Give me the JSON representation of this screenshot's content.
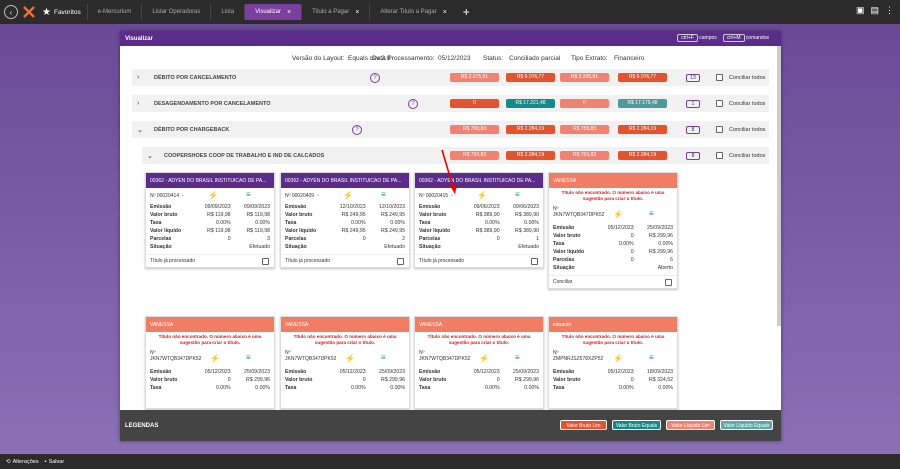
{
  "favorites_label": "Favoritos",
  "tabs": [
    {
      "label": "e-Mercurium"
    },
    {
      "label": "Listar Operadoras"
    },
    {
      "label": "Lista"
    },
    {
      "label": "Visualizar",
      "active": true
    },
    {
      "label": "Titulo a Pagar"
    },
    {
      "label": "Alterar Titulo a Pagar"
    }
  ],
  "window": {
    "title": "Visualizar",
    "kb1": "ctrl+F",
    "kb1_label": "campos",
    "kb2": "ctrl+M",
    "kb2_label": "comandos"
  },
  "info": {
    "layout_label": "Versão do Layout:",
    "layout_value": "Equals csv 2.0",
    "proc_label": "Data Processamento:",
    "proc_value": "05/12/2023",
    "status_label": "Status:",
    "status_value": "Conciliado parcial",
    "tipo_label": "Tipo Extrato:",
    "tipo_value": "Financeiro"
  },
  "rows": [
    {
      "label": "DÉBITO POR CANCELAMENTO",
      "pills": [
        "R$ 2.275,91",
        "R$ 6.076,77",
        "R$ 2.200,91",
        "R$ 6.076,77"
      ],
      "count": "13",
      "conciliar": "Conciliar todos",
      "chev": "›"
    },
    {
      "label": "DESAGENDAMENTO POR CANCELAMENTO",
      "pills": [
        "0",
        "R$ 17.221,48",
        "0",
        "R$ 17.179,48"
      ],
      "count": "1",
      "conciliar": "Conciliar todos",
      "chev": "›"
    },
    {
      "label": "DÉBITO POR CHARGEBACK",
      "pills": [
        "R$ 759,83",
        "R$ 2.284,19",
        "R$ 759,83",
        "R$ 2.284,19"
      ],
      "count": "8",
      "conciliar": "Conciliar todos",
      "chev": "⌄"
    },
    {
      "label": "COOPERSHOES COOP DE TRABALHO E IND DE CALCADOS",
      "pills": [
        "R$ 759,83",
        "R$ 2.284,19",
        "R$ 759,83",
        "R$ 2.284,19"
      ],
      "count": "8",
      "conciliar": "Conciliar todos",
      "chev": "⌄"
    }
  ],
  "cards_row1": [
    {
      "title": "00362 - ADYEN DO BRASIL INSTITUICAO DE PA...",
      "nr": "Nº 00020414",
      "emissao": [
        "09/09/2023",
        "09/09/2023"
      ],
      "bruto": [
        "R$ 119,98",
        "R$ 119,98"
      ],
      "taxa": [
        "0.00%",
        "0.00%"
      ],
      "liquido": [
        "R$ 119,98",
        "R$ 119,98"
      ],
      "parcelas": [
        "0",
        "3"
      ],
      "situacao": "Efetuado",
      "footer": "Título já processado"
    },
    {
      "title": "00362 - ADYEN DO BRASIL INSTITUICAO DE PA...",
      "nr": "Nº 00020409",
      "emissao": [
        "12/10/2023",
        "12/10/2023"
      ],
      "bruto": [
        "R$ 249,95",
        "R$ 249,95"
      ],
      "taxa": [
        "0.00%",
        "0.00%"
      ],
      "liquido": [
        "R$ 249,95",
        "R$ 249,95"
      ],
      "parcelas": [
        "0",
        "2"
      ],
      "situacao": "Efetuado",
      "footer": "Título já processado"
    },
    {
      "title": "00362 - ADYEN DO BRASIL INSTITUICAO DE PA...",
      "nr": "Nº 00020415",
      "emissao": [
        "09/06/2023",
        "09/06/2023"
      ],
      "bruto": [
        "R$ 389,90",
        "R$ 389,90"
      ],
      "taxa": [
        "0.00%",
        "0.00%"
      ],
      "liquido": [
        "R$ 389,90",
        "R$ 389,90"
      ],
      "parcelas": [
        "0",
        "1"
      ],
      "situacao": "Efetuado",
      "footer": "Título já processado"
    },
    {
      "title": "VANESSA",
      "err": "Título não encontrado. O número abaixo é uma sugestão para criar o título.",
      "nr_label": "Nº",
      "nr": "JKN7WTQB347DPK52",
      "emissao": [
        "05/12/2023",
        "25/09/2023"
      ],
      "bruto": [
        "0",
        "R$ 299,96"
      ],
      "taxa": [
        "0.00%",
        "0.00%"
      ],
      "liquido": [
        "0",
        "R$ 299,96"
      ],
      "parcelas": [
        "0",
        "6"
      ],
      "situacao": "Aberto",
      "footer": "Conciliar"
    }
  ],
  "cards_row2": [
    {
      "title": "VANESSA",
      "err": "Título não encontrado. O número abaixo é uma sugestão para criar o título.",
      "nr_label": "Nº",
      "nr": "JKN7WTQB347DPK52",
      "emissao": [
        "05/12/2023",
        "25/09/2023"
      ],
      "bruto": [
        "0",
        "R$ 299,96"
      ],
      "taxa": [
        "0.00%",
        "0.00%"
      ]
    },
    {
      "title": "VANESSA",
      "err": "Título não encontrado. O número abaixo é uma sugestão para criar o título.",
      "nr_label": "Nº",
      "nr": "JKN7WTQB347DPK52",
      "emissao": [
        "05/12/2023",
        "25/09/2023"
      ],
      "bruto": [
        "0",
        "R$ 299,96"
      ],
      "taxa": [
        "0.00%",
        "0.00%"
      ]
    },
    {
      "title": "VANESSA",
      "err": "Título não encontrado. O número abaixo é uma sugestão para criar o título.",
      "nr_label": "Nº",
      "nr": "JKN7WTQB347DPK52",
      "emissao": [
        "05/12/2023",
        "25/09/2023"
      ],
      "bruto": [
        "0",
        "R$ 299,96"
      ],
      "taxa": [
        "0.00%",
        "0.00%"
      ]
    },
    {
      "title": "eduardo",
      "err": "Título não encontrado. O número abaixo é uma sugestão para criar o título.",
      "nr_label": "Nº",
      "nr": "ZMPNRJSZ678XZP52",
      "emissao": [
        "05/12/2023",
        "18/09/2023"
      ],
      "bruto": [
        "0",
        "R$ 324,52"
      ],
      "taxa": [
        "0.00%",
        "0.00%"
      ]
    }
  ],
  "labels": {
    "emissao": "Emissão",
    "bruto": "Valor bruto",
    "taxa": "Taxa",
    "liquido": "Valor líquido",
    "parcelas": "Parcelas",
    "situacao": "Situação"
  },
  "legend": {
    "title": "LEGENDAS",
    "b1": "Valor Bruto Lim",
    "b2": "Valor Bruto Equals",
    "b3": "Valor Líquido Lim",
    "b4": "Valor Líquido Equals"
  },
  "bottom": {
    "alteracoes": "Alterações",
    "salvar": "Salvar"
  },
  "colors": {
    "accent": "#5b2c8a",
    "salmon": "#f08272",
    "red": "#e2532f",
    "teal": "#148a8a"
  }
}
